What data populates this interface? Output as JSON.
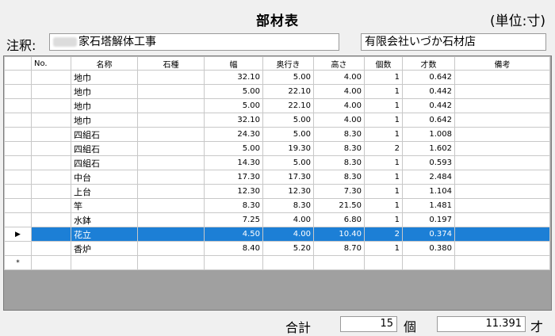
{
  "header": {
    "title": "部材表",
    "unit": "(単位:寸)"
  },
  "note": {
    "label": "注釈:",
    "value": "家石塔解体工事",
    "company": "有限会社いづか石材店"
  },
  "columns": [
    "No.",
    "名称",
    "石種",
    "幅",
    "奥行き",
    "高さ",
    "個数",
    "才数",
    "備考"
  ],
  "rows": [
    {
      "no": "",
      "name": "地巾",
      "stone": "",
      "w": "32.10",
      "d": "5.00",
      "h": "4.00",
      "qty": "1",
      "sai": "0.642",
      "note": ""
    },
    {
      "no": "",
      "name": "地巾",
      "stone": "",
      "w": "5.00",
      "d": "22.10",
      "h": "4.00",
      "qty": "1",
      "sai": "0.442",
      "note": ""
    },
    {
      "no": "",
      "name": "地巾",
      "stone": "",
      "w": "5.00",
      "d": "22.10",
      "h": "4.00",
      "qty": "1",
      "sai": "0.442",
      "note": ""
    },
    {
      "no": "",
      "name": "地巾",
      "stone": "",
      "w": "32.10",
      "d": "5.00",
      "h": "4.00",
      "qty": "1",
      "sai": "0.642",
      "note": ""
    },
    {
      "no": "",
      "name": "四組石",
      "stone": "",
      "w": "24.30",
      "d": "5.00",
      "h": "8.30",
      "qty": "1",
      "sai": "1.008",
      "note": ""
    },
    {
      "no": "",
      "name": "四組石",
      "stone": "",
      "w": "5.00",
      "d": "19.30",
      "h": "8.30",
      "qty": "2",
      "sai": "1.602",
      "note": ""
    },
    {
      "no": "",
      "name": "四組石",
      "stone": "",
      "w": "14.30",
      "d": "5.00",
      "h": "8.30",
      "qty": "1",
      "sai": "0.593",
      "note": ""
    },
    {
      "no": "",
      "name": "中台",
      "stone": "",
      "w": "17.30",
      "d": "17.30",
      "h": "8.30",
      "qty": "1",
      "sai": "2.484",
      "note": ""
    },
    {
      "no": "",
      "name": "上台",
      "stone": "",
      "w": "12.30",
      "d": "12.30",
      "h": "7.30",
      "qty": "1",
      "sai": "1.104",
      "note": ""
    },
    {
      "no": "",
      "name": "竿",
      "stone": "",
      "w": "8.30",
      "d": "8.30",
      "h": "21.50",
      "qty": "1",
      "sai": "1.481",
      "note": ""
    },
    {
      "no": "",
      "name": "水鉢",
      "stone": "",
      "w": "7.25",
      "d": "4.00",
      "h": "6.80",
      "qty": "1",
      "sai": "0.197",
      "note": ""
    },
    {
      "no": "",
      "name": "花立",
      "stone": "",
      "w": "4.50",
      "d": "4.00",
      "h": "10.40",
      "qty": "2",
      "sai": "0.374",
      "note": "",
      "selected": true
    },
    {
      "no": "",
      "name": "香炉",
      "stone": "",
      "w": "8.40",
      "d": "5.20",
      "h": "8.70",
      "qty": "1",
      "sai": "0.380",
      "note": ""
    }
  ],
  "selector": {
    "current": "▶",
    "new": "*"
  },
  "totals": {
    "label": "合計",
    "count": "15",
    "count_unit": "個",
    "sai": "11.391",
    "sai_unit": "才"
  }
}
